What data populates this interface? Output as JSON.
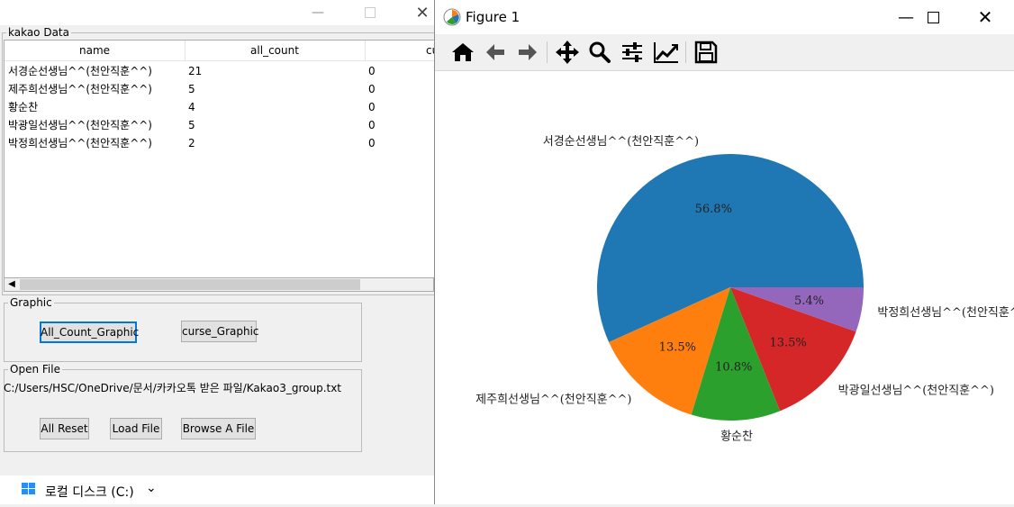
{
  "app": {
    "table_group_title": "kakao Data",
    "columns": [
      "name",
      "all_count",
      "cu"
    ],
    "rows": [
      {
        "name": "서경순선생님^^(천안직훈^^)",
        "all_count": "21",
        "curse": "0"
      },
      {
        "name": "제주희선생님^^(천안직훈^^)",
        "all_count": "5",
        "curse": "0"
      },
      {
        "name": "황순찬",
        "all_count": "4",
        "curse": "0"
      },
      {
        "name": "박광일선생님^^(천안직훈^^)",
        "all_count": "5",
        "curse": "0"
      },
      {
        "name": "박정희선생님^^(천안직훈^^)",
        "all_count": "2",
        "curse": "0"
      }
    ],
    "graphic_group_title": "Graphic",
    "all_count_button": "All_Count_Graphic",
    "curse_button": "curse_Graphic",
    "open_file_group_title": "Open File",
    "file_path": "C:/Users/HSC/OneDrive/문서/카카오톡 받은 파일/Kakao3_group.txt",
    "all_reset_button": "All Reset",
    "load_file_button": "Load File",
    "browse_button": "Browse A File"
  },
  "explorer": {
    "label": "로컬 디스크 (C:)"
  },
  "figure": {
    "title": "Figure 1"
  },
  "chart_data": {
    "type": "pie",
    "categories": [
      "서경순선생님^^(천안직훈^^)",
      "제주희선생님^^(천안직훈^^)",
      "황순찬",
      "박광일선생님^^(천안직훈^^)",
      "박정희선생님^^(천안직훈^^)"
    ],
    "values": [
      21,
      5,
      4,
      5,
      2
    ],
    "percent_labels": [
      "56.8%",
      "13.5%",
      "10.8%",
      "13.5%",
      "5.4%"
    ],
    "colors": [
      "#1f77b4",
      "#ff7f0e",
      "#2ca02c",
      "#d62728",
      "#9467bd"
    ]
  }
}
